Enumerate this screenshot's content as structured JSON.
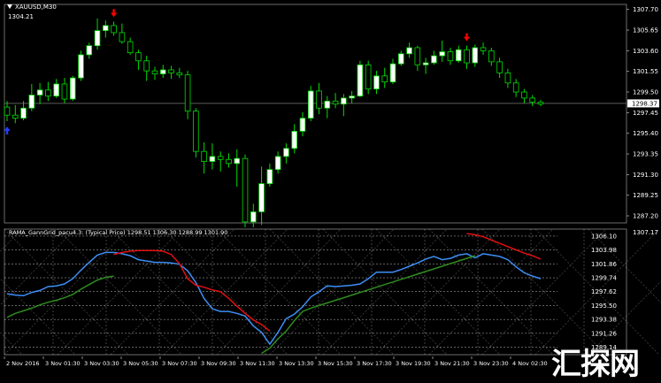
{
  "window": {
    "symbol": "XAUUSD,M30",
    "price_info": "1304.21"
  },
  "main_axis": {
    "labels": [
      "1307.70",
      "1305.65",
      "1303.60",
      "1301.55",
      "1299.50",
      "1297.45",
      "1295.40",
      "1293.35",
      "1291.30",
      "1289.25",
      "1287.20"
    ],
    "current_price": "1298.37"
  },
  "indicator": {
    "title": "RAMA_GannGrid_pacu4.3: (Typical Price) 1298.51 1306.30 1288.99 1301.90",
    "axis_labels": [
      "1307.17",
      "1306.10",
      "1303.98",
      "1301.86",
      "1299.74",
      "1297.62",
      "1295.50",
      "1293.38",
      "1291.26",
      "1289.14"
    ]
  },
  "time_axis": {
    "labels": [
      "2 Nov 2016",
      "3 Nov 01:30",
      "3 Nov 03:30",
      "3 Nov 05:30",
      "3 Nov 07:30",
      "3 Nov 09:30",
      "3 Nov 11:30",
      "3 Nov 13:30",
      "3 Nov 15:30",
      "3 Nov 17:30",
      "3 Nov 19:30",
      "3 Nov 21:30",
      "3 Nov 23:30",
      "4 Nov 02:30"
    ]
  },
  "watermark": "汇探网",
  "colors": {
    "background": "#000000",
    "bull_candle": "#ffffff",
    "bear_candle": "#000000",
    "candle_outline": "#00dd00",
    "sell_arrow": "#ff0000",
    "buy_arrow": "#1f3fff",
    "main_line": "#3d8ef5",
    "red_line": "#e01010",
    "green_line": "#2e8b1f",
    "grid": "#ffffff"
  },
  "chart_data": {
    "type": "candlestick",
    "timeframe": "M30",
    "ylim": [
      1286.5,
      1308.2
    ],
    "candles": [
      {
        "o": 1298.0,
        "h": 1298.6,
        "l": 1296.6,
        "c": 1297.2
      },
      {
        "o": 1297.2,
        "h": 1298.2,
        "l": 1296.4,
        "c": 1296.9
      },
      {
        "o": 1296.9,
        "h": 1298.6,
        "l": 1296.7,
        "c": 1297.9
      },
      {
        "o": 1297.9,
        "h": 1300.3,
        "l": 1297.6,
        "c": 1299.2
      },
      {
        "o": 1299.2,
        "h": 1300.4,
        "l": 1298.3,
        "c": 1299.7
      },
      {
        "o": 1299.7,
        "h": 1300.5,
        "l": 1298.6,
        "c": 1299.1
      },
      {
        "o": 1299.1,
        "h": 1300.8,
        "l": 1298.9,
        "c": 1300.3
      },
      {
        "o": 1300.3,
        "h": 1300.9,
        "l": 1298.4,
        "c": 1298.8
      },
      {
        "o": 1298.8,
        "h": 1301.1,
        "l": 1298.6,
        "c": 1300.9
      },
      {
        "o": 1300.9,
        "h": 1303.6,
        "l": 1300.6,
        "c": 1303.2
      },
      {
        "o": 1303.2,
        "h": 1304.4,
        "l": 1302.8,
        "c": 1304.1
      },
      {
        "o": 1304.1,
        "h": 1306.8,
        "l": 1303.7,
        "c": 1305.6
      },
      {
        "o": 1305.6,
        "h": 1306.6,
        "l": 1304.9,
        "c": 1306.1
      },
      {
        "o": 1306.1,
        "h": 1306.5,
        "l": 1305.1,
        "c": 1305.4
      },
      {
        "o": 1305.4,
        "h": 1306.3,
        "l": 1304.3,
        "c": 1304.5
      },
      {
        "o": 1304.5,
        "h": 1304.9,
        "l": 1303.2,
        "c": 1303.4
      },
      {
        "o": 1303.4,
        "h": 1303.7,
        "l": 1301.7,
        "c": 1302.6
      },
      {
        "o": 1302.6,
        "h": 1303.1,
        "l": 1300.6,
        "c": 1301.6
      },
      {
        "o": 1301.6,
        "h": 1302.0,
        "l": 1300.7,
        "c": 1301.3
      },
      {
        "o": 1301.3,
        "h": 1302.2,
        "l": 1300.9,
        "c": 1301.7
      },
      {
        "o": 1301.7,
        "h": 1302.1,
        "l": 1300.8,
        "c": 1301.4
      },
      {
        "o": 1301.4,
        "h": 1301.9,
        "l": 1300.9,
        "c": 1301.2
      },
      {
        "o": 1301.2,
        "h": 1301.6,
        "l": 1296.8,
        "c": 1297.6
      },
      {
        "o": 1297.6,
        "h": 1297.9,
        "l": 1293.0,
        "c": 1293.6
      },
      {
        "o": 1293.6,
        "h": 1294.5,
        "l": 1291.4,
        "c": 1292.6
      },
      {
        "o": 1292.6,
        "h": 1294.4,
        "l": 1291.8,
        "c": 1293.1
      },
      {
        "o": 1293.1,
        "h": 1293.6,
        "l": 1291.6,
        "c": 1292.8
      },
      {
        "o": 1292.8,
        "h": 1293.4,
        "l": 1292.0,
        "c": 1292.4
      },
      {
        "o": 1292.4,
        "h": 1293.8,
        "l": 1290.1,
        "c": 1292.9
      },
      {
        "o": 1292.9,
        "h": 1293.3,
        "l": 1285.9,
        "c": 1286.6
      },
      {
        "o": 1286.6,
        "h": 1288.4,
        "l": 1285.6,
        "c": 1287.6
      },
      {
        "o": 1287.6,
        "h": 1292.1,
        "l": 1286.3,
        "c": 1290.4
      },
      {
        "o": 1290.4,
        "h": 1292.4,
        "l": 1290.1,
        "c": 1291.8
      },
      {
        "o": 1291.8,
        "h": 1293.6,
        "l": 1291.4,
        "c": 1293.1
      },
      {
        "o": 1293.1,
        "h": 1294.4,
        "l": 1292.4,
        "c": 1293.9
      },
      {
        "o": 1293.9,
        "h": 1296.3,
        "l": 1293.4,
        "c": 1295.6
      },
      {
        "o": 1295.6,
        "h": 1297.5,
        "l": 1295.1,
        "c": 1296.9
      },
      {
        "o": 1296.9,
        "h": 1300.1,
        "l": 1296.6,
        "c": 1299.6
      },
      {
        "o": 1299.6,
        "h": 1300.4,
        "l": 1297.3,
        "c": 1297.9
      },
      {
        "o": 1297.9,
        "h": 1299.1,
        "l": 1296.9,
        "c": 1298.6
      },
      {
        "o": 1298.6,
        "h": 1299.4,
        "l": 1297.9,
        "c": 1298.3
      },
      {
        "o": 1298.3,
        "h": 1299.3,
        "l": 1297.1,
        "c": 1298.9
      },
      {
        "o": 1298.9,
        "h": 1299.6,
        "l": 1298.4,
        "c": 1299.1
      },
      {
        "o": 1299.1,
        "h": 1302.6,
        "l": 1299.0,
        "c": 1302.2
      },
      {
        "o": 1302.2,
        "h": 1302.6,
        "l": 1299.3,
        "c": 1299.8
      },
      {
        "o": 1299.8,
        "h": 1301.6,
        "l": 1299.3,
        "c": 1301.1
      },
      {
        "o": 1301.1,
        "h": 1301.9,
        "l": 1299.9,
        "c": 1300.5
      },
      {
        "o": 1300.5,
        "h": 1302.8,
        "l": 1300.3,
        "c": 1302.3
      },
      {
        "o": 1302.3,
        "h": 1303.6,
        "l": 1302.1,
        "c": 1303.3
      },
      {
        "o": 1303.3,
        "h": 1304.4,
        "l": 1302.9,
        "c": 1303.9
      },
      {
        "o": 1303.9,
        "h": 1304.1,
        "l": 1301.6,
        "c": 1302.2
      },
      {
        "o": 1302.2,
        "h": 1302.9,
        "l": 1301.3,
        "c": 1302.4
      },
      {
        "o": 1302.4,
        "h": 1303.6,
        "l": 1302.2,
        "c": 1303.1
      },
      {
        "o": 1303.1,
        "h": 1304.6,
        "l": 1302.5,
        "c": 1303.5
      },
      {
        "o": 1303.5,
        "h": 1303.9,
        "l": 1302.2,
        "c": 1302.6
      },
      {
        "o": 1302.6,
        "h": 1304.1,
        "l": 1302.4,
        "c": 1303.7
      },
      {
        "o": 1303.7,
        "h": 1304.1,
        "l": 1301.8,
        "c": 1302.4
      },
      {
        "o": 1302.4,
        "h": 1304.2,
        "l": 1302.0,
        "c": 1303.9
      },
      {
        "o": 1303.9,
        "h": 1304.4,
        "l": 1303.2,
        "c": 1303.6
      },
      {
        "o": 1303.6,
        "h": 1303.9,
        "l": 1302.1,
        "c": 1302.5
      },
      {
        "o": 1302.5,
        "h": 1302.9,
        "l": 1300.9,
        "c": 1301.4
      },
      {
        "o": 1301.4,
        "h": 1301.8,
        "l": 1299.9,
        "c": 1300.4
      },
      {
        "o": 1300.4,
        "h": 1300.8,
        "l": 1299.0,
        "c": 1299.5
      },
      {
        "o": 1299.5,
        "h": 1299.8,
        "l": 1298.4,
        "c": 1298.9
      },
      {
        "o": 1298.9,
        "h": 1299.2,
        "l": 1298.1,
        "c": 1298.5
      },
      {
        "o": 1298.5,
        "h": 1298.7,
        "l": 1298.1,
        "c": 1298.3
      }
    ],
    "sell_signals": [
      13,
      56
    ],
    "buy_signals": [
      0,
      31
    ],
    "indicator_ylim": [
      1288.0,
      1307.17
    ],
    "indicator_series": [
      {
        "color": "#3d8ef5",
        "values": [
          1297.3,
          1297.1,
          1297.0,
          1297.5,
          1297.8,
          1298.4,
          1298.5,
          1298.8,
          1299.6,
          1300.9,
          1302.1,
          1303.2,
          1303.6,
          1303.6,
          1303.4,
          1303.1,
          1302.5,
          1302.3,
          1302.1,
          1302.1,
          1302.0,
          1301.8,
          1300.8,
          1299.0,
          1296.6,
          1295.0,
          1294.6,
          1294.6,
          1294.3,
          1293.9,
          1292.4,
          1291.4,
          1289.6,
          1291.4,
          1293.5,
          1294.2,
          1295.3,
          1296.8,
          1297.6,
          1298.5,
          1298.4,
          1298.5,
          1298.6,
          1298.8,
          1299.6,
          1300.6,
          1300.6,
          1300.6,
          1301.0,
          1301.5,
          1302.0,
          1302.6,
          1303.0,
          1302.5,
          1302.7,
          1303.2,
          1303.4,
          1302.8,
          1303.4,
          1303.2,
          1303.0,
          1302.5,
          1301.4,
          1300.5,
          1300.0,
          1299.6
        ]
      },
      {
        "color": "#2e8b1f",
        "values": [
          1293.7,
          1294.3,
          1294.7,
          1295.1,
          1295.6,
          1296.0,
          1296.3,
          1296.7,
          1297.2,
          1298.0,
          1298.7,
          1299.4,
          1299.8,
          1300.0,
          null,
          null,
          null,
          null,
          null,
          null,
          null,
          null,
          null,
          null,
          null,
          null,
          null,
          null,
          null,
          null,
          null,
          1288.2,
          1289.0,
          1290.4,
          1291.6,
          1293.2,
          1294.6,
          1295.1,
          1295.5,
          1295.9,
          1296.3,
          1296.7,
          1297.1,
          1297.5,
          1297.9,
          1298.3,
          1298.7,
          1299.1,
          1299.5,
          1299.9,
          1300.3,
          1300.7,
          1301.1,
          1301.5,
          1301.9,
          1302.3,
          1302.7,
          1303.1,
          null,
          null,
          null,
          null,
          null,
          null,
          null,
          null
        ]
      },
      {
        "color": "#e01010",
        "values": [
          null,
          null,
          null,
          null,
          null,
          null,
          null,
          null,
          null,
          null,
          null,
          null,
          null,
          1303.3,
          1303.6,
          1303.8,
          1303.9,
          1303.9,
          1303.9,
          1303.8,
          1303.3,
          1301.9,
          1299.6,
          1298.6,
          1298.3,
          1297.9,
          1297.6,
          1296.6,
          1295.4,
          1294.3,
          1293.3,
          1292.6,
          1291.6,
          null,
          null,
          null,
          null,
          null,
          null,
          null,
          null,
          null,
          null,
          null,
          null,
          null,
          null,
          null,
          null,
          null,
          null,
          null,
          null,
          null,
          null,
          null,
          1306.5,
          1306.3,
          1306.0,
          1305.5,
          1305.0,
          1304.5,
          1304.0,
          1303.5,
          1303.1,
          1302.6
        ]
      }
    ]
  }
}
